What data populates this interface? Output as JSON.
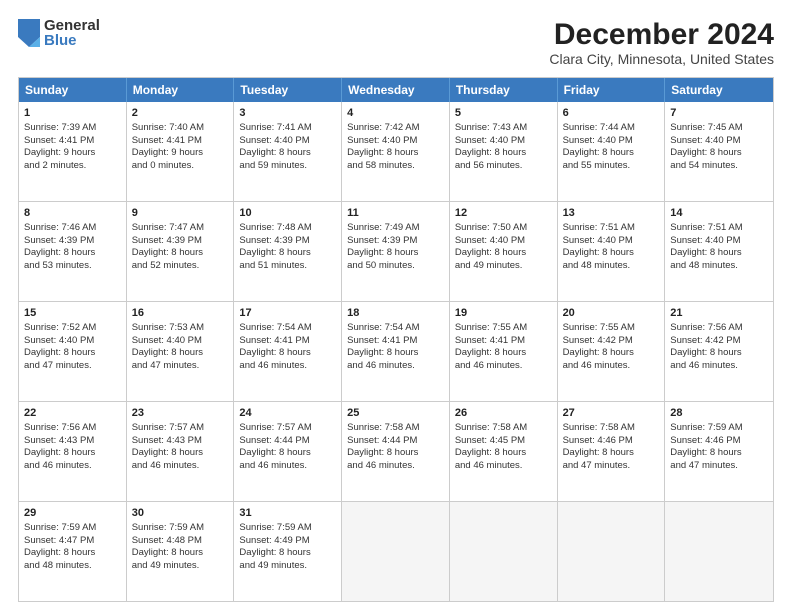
{
  "logo": {
    "general": "General",
    "blue": "Blue"
  },
  "header": {
    "title": "December 2024",
    "subtitle": "Clara City, Minnesota, United States"
  },
  "weekdays": [
    "Sunday",
    "Monday",
    "Tuesday",
    "Wednesday",
    "Thursday",
    "Friday",
    "Saturday"
  ],
  "weeks": [
    [
      {
        "day": "1",
        "info": "Sunrise: 7:39 AM\nSunset: 4:41 PM\nDaylight: 9 hours\nand 2 minutes."
      },
      {
        "day": "2",
        "info": "Sunrise: 7:40 AM\nSunset: 4:41 PM\nDaylight: 9 hours\nand 0 minutes."
      },
      {
        "day": "3",
        "info": "Sunrise: 7:41 AM\nSunset: 4:40 PM\nDaylight: 8 hours\nand 59 minutes."
      },
      {
        "day": "4",
        "info": "Sunrise: 7:42 AM\nSunset: 4:40 PM\nDaylight: 8 hours\nand 58 minutes."
      },
      {
        "day": "5",
        "info": "Sunrise: 7:43 AM\nSunset: 4:40 PM\nDaylight: 8 hours\nand 56 minutes."
      },
      {
        "day": "6",
        "info": "Sunrise: 7:44 AM\nSunset: 4:40 PM\nDaylight: 8 hours\nand 55 minutes."
      },
      {
        "day": "7",
        "info": "Sunrise: 7:45 AM\nSunset: 4:40 PM\nDaylight: 8 hours\nand 54 minutes."
      }
    ],
    [
      {
        "day": "8",
        "info": "Sunrise: 7:46 AM\nSunset: 4:39 PM\nDaylight: 8 hours\nand 53 minutes."
      },
      {
        "day": "9",
        "info": "Sunrise: 7:47 AM\nSunset: 4:39 PM\nDaylight: 8 hours\nand 52 minutes."
      },
      {
        "day": "10",
        "info": "Sunrise: 7:48 AM\nSunset: 4:39 PM\nDaylight: 8 hours\nand 51 minutes."
      },
      {
        "day": "11",
        "info": "Sunrise: 7:49 AM\nSunset: 4:39 PM\nDaylight: 8 hours\nand 50 minutes."
      },
      {
        "day": "12",
        "info": "Sunrise: 7:50 AM\nSunset: 4:40 PM\nDaylight: 8 hours\nand 49 minutes."
      },
      {
        "day": "13",
        "info": "Sunrise: 7:51 AM\nSunset: 4:40 PM\nDaylight: 8 hours\nand 48 minutes."
      },
      {
        "day": "14",
        "info": "Sunrise: 7:51 AM\nSunset: 4:40 PM\nDaylight: 8 hours\nand 48 minutes."
      }
    ],
    [
      {
        "day": "15",
        "info": "Sunrise: 7:52 AM\nSunset: 4:40 PM\nDaylight: 8 hours\nand 47 minutes."
      },
      {
        "day": "16",
        "info": "Sunrise: 7:53 AM\nSunset: 4:40 PM\nDaylight: 8 hours\nand 47 minutes."
      },
      {
        "day": "17",
        "info": "Sunrise: 7:54 AM\nSunset: 4:41 PM\nDaylight: 8 hours\nand 46 minutes."
      },
      {
        "day": "18",
        "info": "Sunrise: 7:54 AM\nSunset: 4:41 PM\nDaylight: 8 hours\nand 46 minutes."
      },
      {
        "day": "19",
        "info": "Sunrise: 7:55 AM\nSunset: 4:41 PM\nDaylight: 8 hours\nand 46 minutes."
      },
      {
        "day": "20",
        "info": "Sunrise: 7:55 AM\nSunset: 4:42 PM\nDaylight: 8 hours\nand 46 minutes."
      },
      {
        "day": "21",
        "info": "Sunrise: 7:56 AM\nSunset: 4:42 PM\nDaylight: 8 hours\nand 46 minutes."
      }
    ],
    [
      {
        "day": "22",
        "info": "Sunrise: 7:56 AM\nSunset: 4:43 PM\nDaylight: 8 hours\nand 46 minutes."
      },
      {
        "day": "23",
        "info": "Sunrise: 7:57 AM\nSunset: 4:43 PM\nDaylight: 8 hours\nand 46 minutes."
      },
      {
        "day": "24",
        "info": "Sunrise: 7:57 AM\nSunset: 4:44 PM\nDaylight: 8 hours\nand 46 minutes."
      },
      {
        "day": "25",
        "info": "Sunrise: 7:58 AM\nSunset: 4:44 PM\nDaylight: 8 hours\nand 46 minutes."
      },
      {
        "day": "26",
        "info": "Sunrise: 7:58 AM\nSunset: 4:45 PM\nDaylight: 8 hours\nand 46 minutes."
      },
      {
        "day": "27",
        "info": "Sunrise: 7:58 AM\nSunset: 4:46 PM\nDaylight: 8 hours\nand 47 minutes."
      },
      {
        "day": "28",
        "info": "Sunrise: 7:59 AM\nSunset: 4:46 PM\nDaylight: 8 hours\nand 47 minutes."
      }
    ],
    [
      {
        "day": "29",
        "info": "Sunrise: 7:59 AM\nSunset: 4:47 PM\nDaylight: 8 hours\nand 48 minutes."
      },
      {
        "day": "30",
        "info": "Sunrise: 7:59 AM\nSunset: 4:48 PM\nDaylight: 8 hours\nand 49 minutes."
      },
      {
        "day": "31",
        "info": "Sunrise: 7:59 AM\nSunset: 4:49 PM\nDaylight: 8 hours\nand 49 minutes."
      },
      {
        "day": "",
        "info": ""
      },
      {
        "day": "",
        "info": ""
      },
      {
        "day": "",
        "info": ""
      },
      {
        "day": "",
        "info": ""
      }
    ]
  ]
}
